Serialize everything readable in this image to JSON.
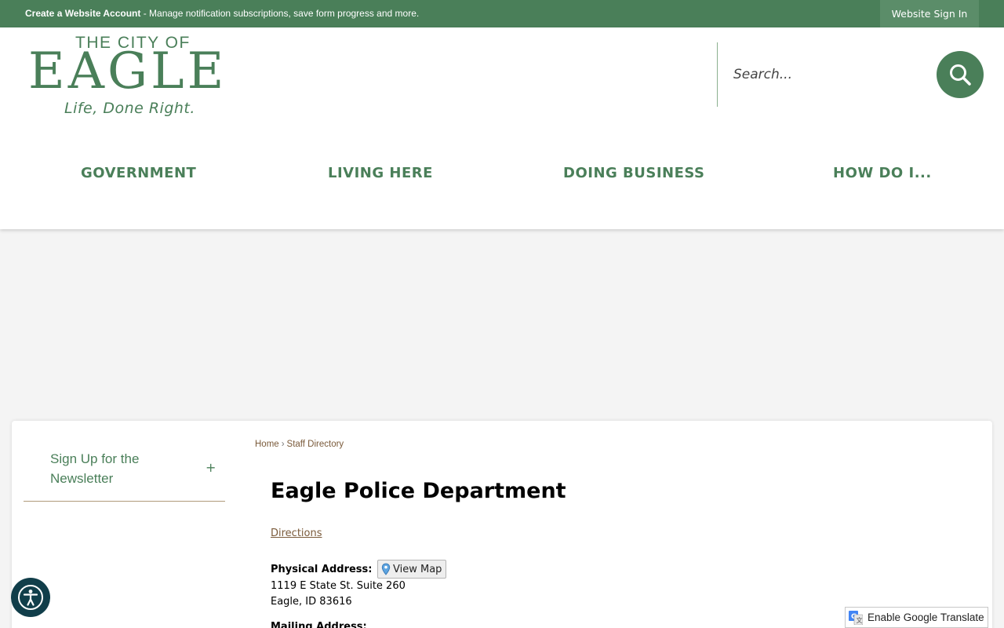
{
  "topbar": {
    "create_account": "Create a Website Account",
    "message": " - Manage notification subscriptions, save form progress and more.",
    "signin": "Website Sign In"
  },
  "logo": {
    "line1": "THE CITY OF",
    "line2": "EAGLE",
    "tagline": "Life, Done Right."
  },
  "search": {
    "placeholder": "Search..."
  },
  "nav": {
    "items": [
      {
        "label": "GOVERNMENT"
      },
      {
        "label": "LIVING HERE"
      },
      {
        "label": "DOING BUSINESS"
      },
      {
        "label": "HOW DO I..."
      }
    ]
  },
  "sidebar": {
    "items": [
      {
        "label": "Sign Up for the Newsletter",
        "toggle": "+"
      }
    ]
  },
  "breadcrumb": {
    "home": "Home",
    "separator": "›",
    "current": "Staff Directory"
  },
  "main": {
    "title": "Eagle Police Department",
    "directions": "Directions",
    "physical_label": "Physical Address:",
    "view_map": "View Map",
    "address_line1": "1119 E State St. Suite 260",
    "address_line2": "Eagle, ID 83616",
    "mailing_label": "Mailing Address:"
  },
  "widgets": {
    "translate": "Enable Google Translate"
  },
  "colors": {
    "brand_green": "#4a7f59",
    "link_brown": "#7a5a3a",
    "accessibility_bg": "#113e4a"
  },
  "icons": {
    "search": "search-icon",
    "map_pin": "map-pin-icon",
    "accessibility": "accessibility-icon",
    "google_translate": "google-translate-icon"
  }
}
